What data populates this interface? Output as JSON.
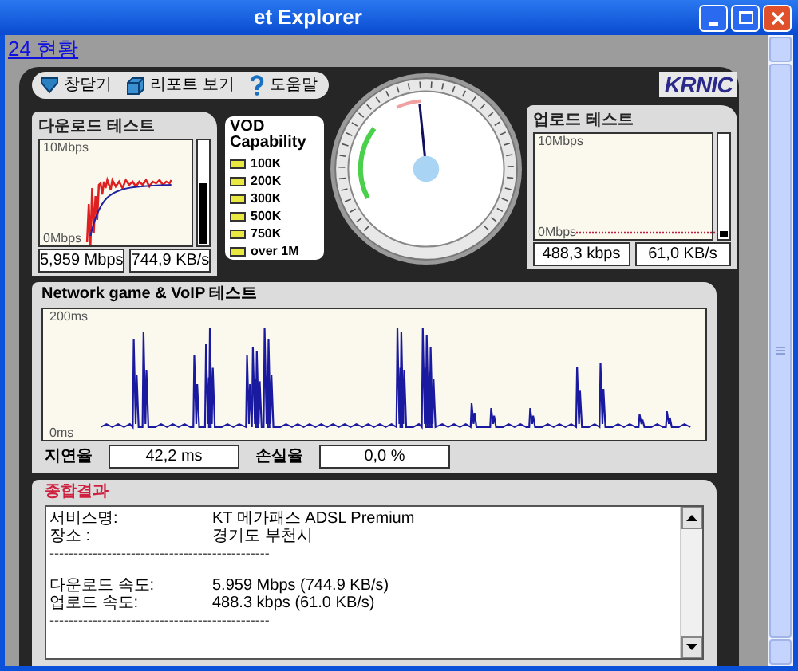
{
  "window": {
    "title": "et Explorer"
  },
  "page_link": "24 현황",
  "toolbar": [
    {
      "kind": "close",
      "label": "창닫기"
    },
    {
      "kind": "report",
      "label": "리포트 보기"
    },
    {
      "kind": "help",
      "label": "도움말"
    }
  ],
  "logo": "KRNIC",
  "download": {
    "title": "다운로드 테스트",
    "axis_top": "10Mbps",
    "axis_bottom": "0Mbps",
    "level": 0.6,
    "readings": [
      "5,959 Mbps",
      "744,9 KB/s"
    ]
  },
  "vod": {
    "title": [
      "VOD",
      "Capability"
    ],
    "items": [
      "100K",
      "200K",
      "300K",
      "500K",
      "750K",
      "over 1M"
    ]
  },
  "upload": {
    "title": "업로드 테스트",
    "axis_top": "10Mbps",
    "axis_bottom": "0Mbps",
    "level": 0.06,
    "readings": [
      "488,3 kbps",
      "61,0 KB/s"
    ]
  },
  "network": {
    "title": "Network game & VoIP 테스트",
    "axis_top": "200ms",
    "axis_bottom": "0ms",
    "fields": [
      {
        "label": "지연율",
        "value": "42,2 ms"
      },
      {
        "label": "손실율",
        "value": "0,0 %"
      }
    ]
  },
  "summary": {
    "title": "종합결과",
    "lines": [
      {
        "kind": "pair",
        "label": "서비스명:",
        "value": "KT 메가패스 ADSL Premium"
      },
      {
        "kind": "pair",
        "label": "장소 :",
        "value": "경기도 부천시"
      },
      {
        "kind": "rule",
        "text": "----------------------------------------------"
      },
      {
        "kind": "blank"
      },
      {
        "kind": "pair",
        "label": "다운로드 속도:",
        "value": "5.959 Mbps (744.9 KB/s)"
      },
      {
        "kind": "pair",
        "label": "업로드 속도:",
        "value": "488.3 kbps (61.0 KB/s)"
      },
      {
        "kind": "rule",
        "text": "----------------------------------------------"
      }
    ]
  }
}
